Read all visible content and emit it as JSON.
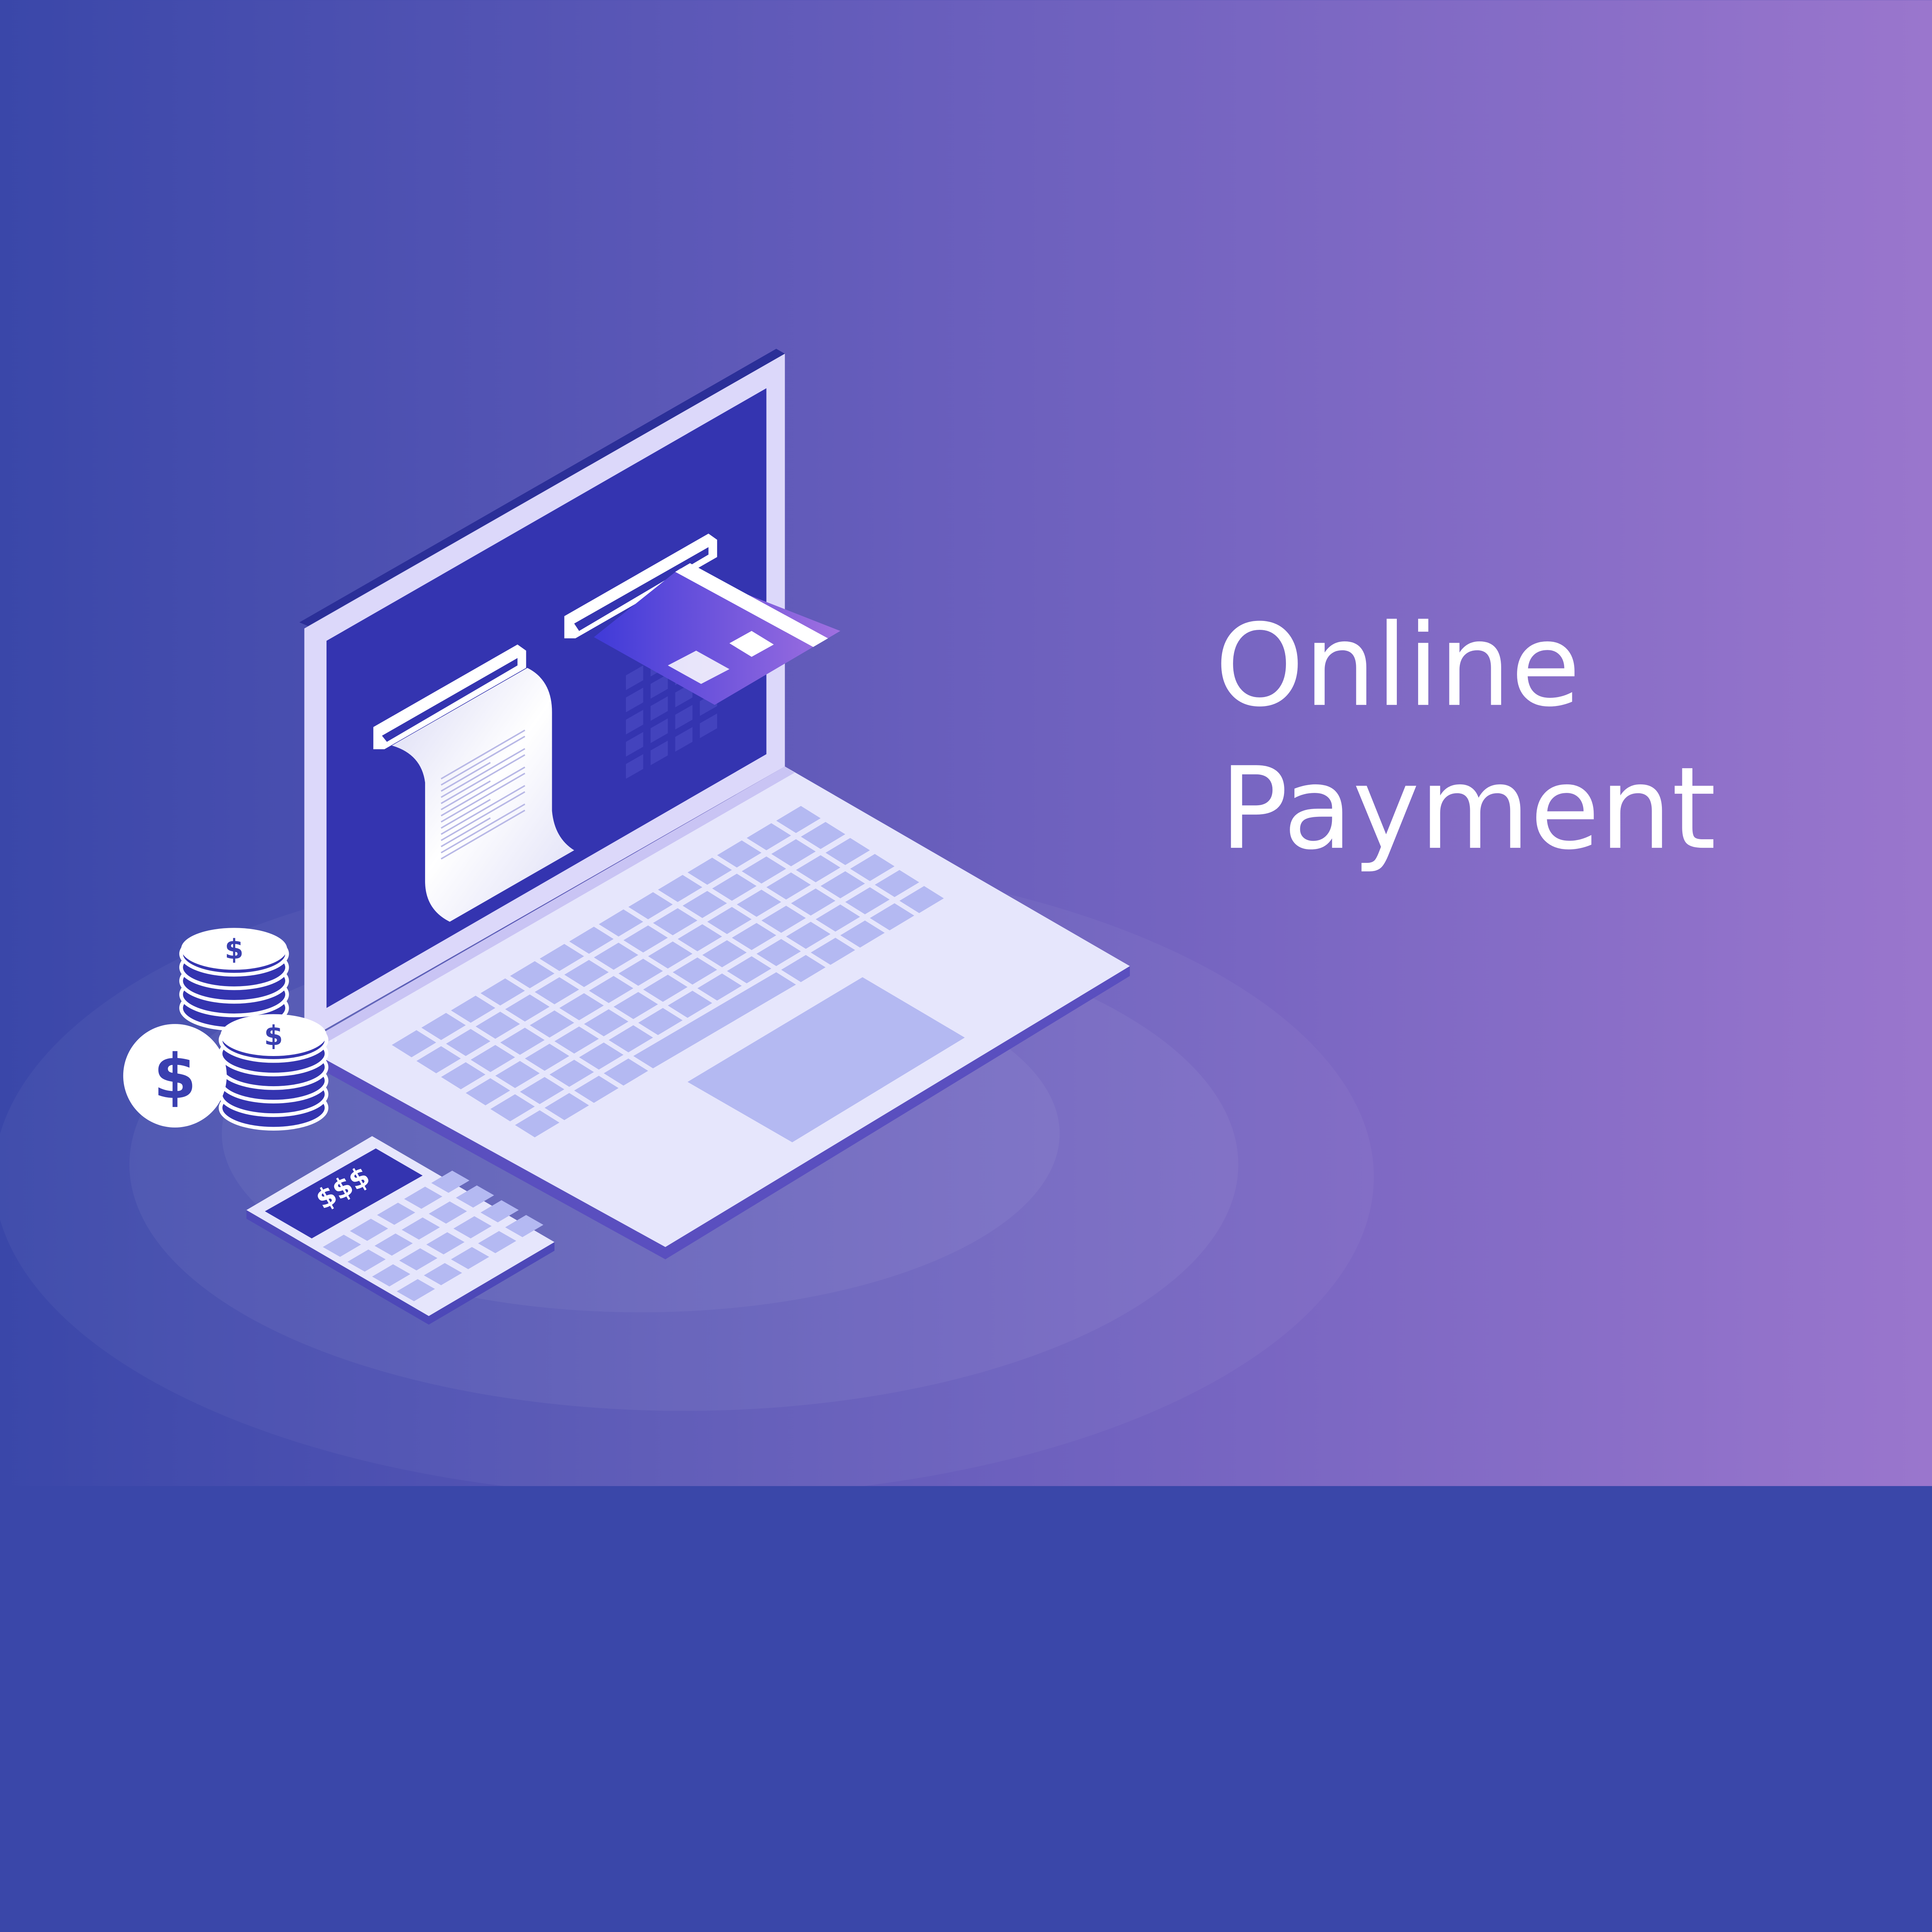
{
  "headline": {
    "line1": "Online",
    "line2": "Payment"
  },
  "illustration": {
    "coin_symbol": "$",
    "calculator_display": "$$$",
    "icons": [
      "laptop-icon",
      "credit-card-icon",
      "receipt-icon",
      "coin-stack-icon",
      "dollar-coin-icon",
      "calculator-icon"
    ]
  },
  "colors": {
    "background_start": "#3a47a9",
    "background_end": "#9a76cd",
    "screen": "#3434b0",
    "laptop_body": "#e6e6fc",
    "keys": "#b4b9f2",
    "text": "#ffffff"
  }
}
